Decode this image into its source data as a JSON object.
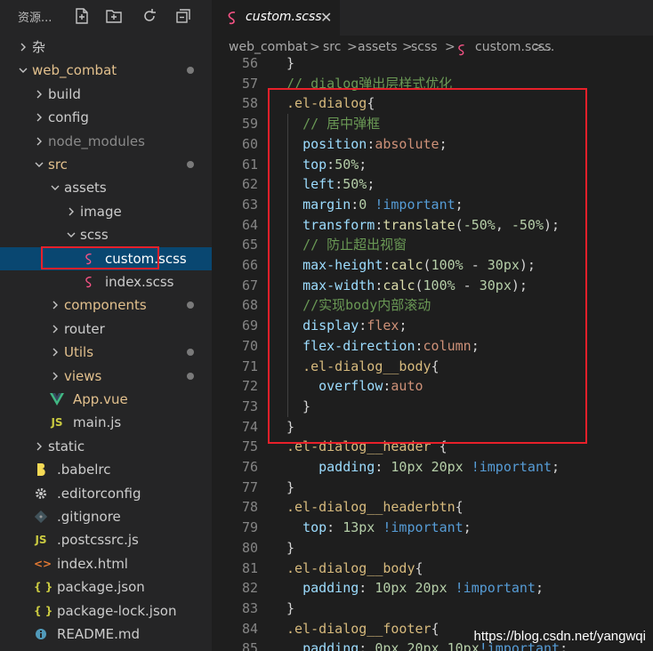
{
  "sidebar": {
    "title": "资源...",
    "tree": [
      {
        "label": "杂",
        "depth": 0,
        "kind": "folder",
        "open": false,
        "color": "norm",
        "dot": false
      },
      {
        "label": "web_combat",
        "depth": 0,
        "kind": "folder",
        "open": true,
        "color": "mod",
        "dot": true
      },
      {
        "label": "build",
        "depth": 1,
        "kind": "folder",
        "open": false,
        "color": "norm",
        "dot": false
      },
      {
        "label": "config",
        "depth": 1,
        "kind": "folder",
        "open": false,
        "color": "norm",
        "dot": false
      },
      {
        "label": "node_modules",
        "depth": 1,
        "kind": "folder",
        "open": false,
        "color": "dim",
        "dot": false
      },
      {
        "label": "src",
        "depth": 1,
        "kind": "folder",
        "open": true,
        "color": "mod",
        "dot": true
      },
      {
        "label": "assets",
        "depth": 2,
        "kind": "folder",
        "open": true,
        "color": "norm",
        "dot": false
      },
      {
        "label": "image",
        "depth": 3,
        "kind": "folder",
        "open": false,
        "color": "norm",
        "dot": false
      },
      {
        "label": "scss",
        "depth": 3,
        "kind": "folder",
        "open": true,
        "color": "norm",
        "dot": false
      },
      {
        "label": "custom.scss",
        "depth": 4,
        "kind": "sass",
        "color": "mod",
        "dot": false,
        "selected": true
      },
      {
        "label": "index.scss",
        "depth": 4,
        "kind": "sass",
        "color": "norm",
        "dot": false
      },
      {
        "label": "components",
        "depth": 2,
        "kind": "folder",
        "open": false,
        "color": "mod",
        "dot": true
      },
      {
        "label": "router",
        "depth": 2,
        "kind": "folder",
        "open": false,
        "color": "norm",
        "dot": false
      },
      {
        "label": "Utils",
        "depth": 2,
        "kind": "folder",
        "open": false,
        "color": "mod",
        "dot": true
      },
      {
        "label": "views",
        "depth": 2,
        "kind": "folder",
        "open": false,
        "color": "mod",
        "dot": true
      },
      {
        "label": "App.vue",
        "depth": 2,
        "kind": "vue",
        "color": "mod",
        "dot": false
      },
      {
        "label": "main.js",
        "depth": 2,
        "kind": "js",
        "color": "norm",
        "dot": false
      },
      {
        "label": "static",
        "depth": 1,
        "kind": "folder",
        "open": false,
        "color": "norm",
        "dot": false
      },
      {
        "label": ".babelrc",
        "depth": 1,
        "kind": "babel",
        "color": "norm",
        "dot": false
      },
      {
        "label": ".editorconfig",
        "depth": 1,
        "kind": "gear",
        "color": "norm",
        "dot": false
      },
      {
        "label": ".gitignore",
        "depth": 1,
        "kind": "git",
        "color": "norm",
        "dot": false
      },
      {
        "label": ".postcssrc.js",
        "depth": 1,
        "kind": "js",
        "color": "norm",
        "dot": false
      },
      {
        "label": "index.html",
        "depth": 1,
        "kind": "html",
        "color": "norm",
        "dot": false
      },
      {
        "label": "package.json",
        "depth": 1,
        "kind": "json",
        "color": "norm",
        "dot": false
      },
      {
        "label": "package-lock.json",
        "depth": 1,
        "kind": "json",
        "color": "norm",
        "dot": false
      },
      {
        "label": "README.md",
        "depth": 1,
        "kind": "info",
        "color": "norm",
        "dot": false
      }
    ],
    "icon_glyphs": {
      "js": "JS",
      "json": "{ }",
      "html": "<>",
      "info": "i"
    }
  },
  "editor": {
    "tab_label": "custom.scss",
    "close_glyph": "✕",
    "breadcrumb": [
      "web_combat",
      "src",
      "assets",
      "scss",
      "custom.scss",
      "..."
    ],
    "breadcrumb_sep": ">",
    "lines": [
      {
        "n": "56",
        "tokens": [
          [
            "p",
            "}"
          ]
        ]
      },
      {
        "n": "57",
        "tokens": [
          [
            "com",
            "// dialog弹出层样式优化"
          ]
        ]
      },
      {
        "n": "58",
        "tokens": [
          [
            "sel",
            ".el-dialog"
          ],
          [
            "p",
            "{"
          ]
        ]
      },
      {
        "n": "59",
        "tokens": [
          [
            "p",
            "  "
          ],
          [
            "com",
            "// 居中弹框"
          ]
        ]
      },
      {
        "n": "60",
        "tokens": [
          [
            "p",
            "  "
          ],
          [
            "prop",
            "position"
          ],
          [
            "p",
            ":"
          ],
          [
            "val",
            "absolute"
          ],
          [
            "p",
            ";"
          ]
        ]
      },
      {
        "n": "61",
        "tokens": [
          [
            "p",
            "  "
          ],
          [
            "prop",
            "top"
          ],
          [
            "p",
            ":"
          ],
          [
            "num",
            "50%"
          ],
          [
            "p",
            ";"
          ]
        ]
      },
      {
        "n": "62",
        "tokens": [
          [
            "p",
            "  "
          ],
          [
            "prop",
            "left"
          ],
          [
            "p",
            ":"
          ],
          [
            "num",
            "50%"
          ],
          [
            "p",
            ";"
          ]
        ]
      },
      {
        "n": "63",
        "tokens": [
          [
            "p",
            "  "
          ],
          [
            "prop",
            "margin"
          ],
          [
            "p",
            ":"
          ],
          [
            "num",
            "0"
          ],
          [
            "p",
            " "
          ],
          [
            "imp",
            "!important"
          ],
          [
            "p",
            ";"
          ]
        ]
      },
      {
        "n": "64",
        "tokens": [
          [
            "p",
            "  "
          ],
          [
            "prop",
            "transform"
          ],
          [
            "p",
            ":"
          ],
          [
            "fn",
            "translate"
          ],
          [
            "p",
            "("
          ],
          [
            "num",
            "-50%"
          ],
          [
            "p",
            ", "
          ],
          [
            "num",
            "-50%"
          ],
          [
            "p",
            ");"
          ]
        ]
      },
      {
        "n": "65",
        "tokens": [
          [
            "p",
            "  "
          ],
          [
            "com",
            "// 防止超出视窗"
          ]
        ]
      },
      {
        "n": "66",
        "tokens": [
          [
            "p",
            "  "
          ],
          [
            "prop",
            "max-height"
          ],
          [
            "p",
            ":"
          ],
          [
            "fn",
            "calc"
          ],
          [
            "p",
            "("
          ],
          [
            "num",
            "100%"
          ],
          [
            "p",
            " - "
          ],
          [
            "num",
            "30px"
          ],
          [
            "p",
            ");"
          ]
        ]
      },
      {
        "n": "67",
        "tokens": [
          [
            "p",
            "  "
          ],
          [
            "prop",
            "max-width"
          ],
          [
            "p",
            ":"
          ],
          [
            "fn",
            "calc"
          ],
          [
            "p",
            "("
          ],
          [
            "num",
            "100%"
          ],
          [
            "p",
            " - "
          ],
          [
            "num",
            "30px"
          ],
          [
            "p",
            ");"
          ]
        ]
      },
      {
        "n": "68",
        "tokens": [
          [
            "p",
            "  "
          ],
          [
            "com",
            "//实现body内部滚动"
          ]
        ]
      },
      {
        "n": "69",
        "tokens": [
          [
            "p",
            "  "
          ],
          [
            "prop",
            "display"
          ],
          [
            "p",
            ":"
          ],
          [
            "val",
            "flex"
          ],
          [
            "p",
            ";"
          ]
        ]
      },
      {
        "n": "70",
        "tokens": [
          [
            "p",
            "  "
          ],
          [
            "prop",
            "flex-direction"
          ],
          [
            "p",
            ":"
          ],
          [
            "val",
            "column"
          ],
          [
            "p",
            ";"
          ]
        ]
      },
      {
        "n": "71",
        "tokens": [
          [
            "p",
            "  "
          ],
          [
            "sel",
            ".el-dialog__body"
          ],
          [
            "p",
            "{"
          ]
        ]
      },
      {
        "n": "72",
        "tokens": [
          [
            "p",
            "    "
          ],
          [
            "prop",
            "overflow"
          ],
          [
            "p",
            ":"
          ],
          [
            "val",
            "auto"
          ]
        ]
      },
      {
        "n": "73",
        "tokens": [
          [
            "p",
            "  }"
          ]
        ]
      },
      {
        "n": "74",
        "tokens": [
          [
            "p",
            "}"
          ]
        ]
      },
      {
        "n": "75",
        "tokens": [
          [
            "sel",
            ".el-dialog__header"
          ],
          [
            "p",
            " {"
          ]
        ]
      },
      {
        "n": "76",
        "tokens": [
          [
            "p",
            "    "
          ],
          [
            "prop",
            "padding"
          ],
          [
            "p",
            ": "
          ],
          [
            "num",
            "10px"
          ],
          [
            "p",
            " "
          ],
          [
            "num",
            "20px"
          ],
          [
            "p",
            " "
          ],
          [
            "imp",
            "!important"
          ],
          [
            "p",
            ";"
          ]
        ]
      },
      {
        "n": "77",
        "tokens": [
          [
            "p",
            "}"
          ]
        ]
      },
      {
        "n": "78",
        "tokens": [
          [
            "sel",
            ".el-dialog__headerbtn"
          ],
          [
            "p",
            "{"
          ]
        ]
      },
      {
        "n": "79",
        "tokens": [
          [
            "p",
            "  "
          ],
          [
            "prop",
            "top"
          ],
          [
            "p",
            ": "
          ],
          [
            "num",
            "13px"
          ],
          [
            "p",
            " "
          ],
          [
            "imp",
            "!important"
          ],
          [
            "p",
            ";"
          ]
        ]
      },
      {
        "n": "80",
        "tokens": [
          [
            "p",
            "}"
          ]
        ]
      },
      {
        "n": "81",
        "tokens": [
          [
            "sel",
            ".el-dialog__body"
          ],
          [
            "p",
            "{"
          ]
        ]
      },
      {
        "n": "82",
        "tokens": [
          [
            "p",
            "  "
          ],
          [
            "prop",
            "padding"
          ],
          [
            "p",
            ": "
          ],
          [
            "num",
            "10px"
          ],
          [
            "p",
            " "
          ],
          [
            "num",
            "20px"
          ],
          [
            "p",
            " "
          ],
          [
            "imp",
            "!important"
          ],
          [
            "p",
            ";"
          ]
        ]
      },
      {
        "n": "83",
        "tokens": [
          [
            "p",
            "}"
          ]
        ]
      },
      {
        "n": "84",
        "tokens": [
          [
            "sel",
            ".el-dialog__footer"
          ],
          [
            "p",
            "{"
          ]
        ]
      },
      {
        "n": "85",
        "tokens": [
          [
            "p",
            "  "
          ],
          [
            "prop",
            "padding"
          ],
          [
            "p",
            ": "
          ],
          [
            "num",
            "0px"
          ],
          [
            "p",
            " "
          ],
          [
            "num",
            "20px"
          ],
          [
            "p",
            " "
          ],
          [
            "num",
            "10px"
          ],
          [
            "imp",
            "!important"
          ],
          [
            "p",
            ";"
          ]
        ]
      }
    ]
  },
  "watermark": "https://blog.csdn.net/yangwqi",
  "colors": {
    "bg": "#1e1e1e",
    "sidebar": "#252526",
    "selection": "#094771",
    "highlight_box": "#e8202a",
    "modified": "#e2c08d",
    "selector": "#d7ba7d",
    "property": "#9cdcfe",
    "value": "#ce9178",
    "number": "#b5cea8",
    "important": "#569cd6",
    "comment": "#6a9955",
    "function": "#dcdcaa"
  }
}
